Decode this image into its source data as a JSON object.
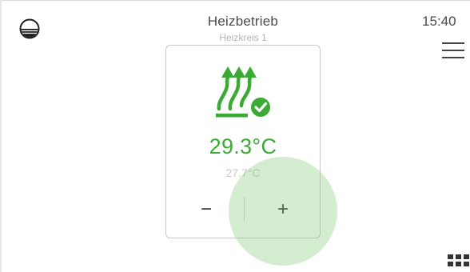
{
  "header": {
    "title": "Heizbetrieb",
    "subtitle": "Heizkreis 1",
    "time": "15:40",
    "status_icon": "water-level-icon",
    "menu_icon": "hamburger-menu-icon"
  },
  "card": {
    "icon": "heating-with-check-icon",
    "current_temperature": "29.3°C",
    "secondary_temperature": "27.7°C",
    "decrease_label": "−",
    "increase_label": "+"
  },
  "footer": {
    "apps_icon": "grid-apps-icon"
  },
  "colors": {
    "accent_green": "#3aaa35",
    "ripple_green": "#b6e3ad",
    "text_dark": "#4a4a4a",
    "text_muted": "#b4b4b4",
    "card_border": "#c8c8c8"
  }
}
